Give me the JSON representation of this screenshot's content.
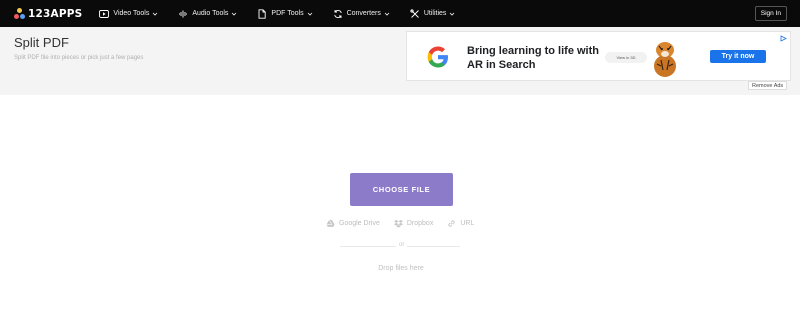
{
  "brand": {
    "name": "123APPS"
  },
  "nav": {
    "items": [
      {
        "label": "Video Tools",
        "icon": "video-play-icon"
      },
      {
        "label": "Audio Tools",
        "icon": "audio-wave-icon"
      },
      {
        "label": "PDF Tools",
        "icon": "pdf-document-icon"
      },
      {
        "label": "Converters",
        "icon": "convert-cycle-icon"
      },
      {
        "label": "Utilities",
        "icon": "tools-icon"
      }
    ],
    "signin_label": "Sign In"
  },
  "page": {
    "title": "Split PDF",
    "subtitle": "Split PDF file into pieces or pick just a few pages"
  },
  "ad": {
    "headline": "Bring learning to life with AR in Search",
    "view_chip": "View in 3D",
    "cta": "Try it now",
    "remove_label": "Remove Ads"
  },
  "upload": {
    "button_label": "CHOOSE FILE",
    "sources": [
      {
        "label": "Google Drive",
        "icon": "google-drive-icon"
      },
      {
        "label": "Dropbox",
        "icon": "dropbox-icon"
      },
      {
        "label": "URL",
        "icon": "link-icon"
      }
    ],
    "or_text": "or",
    "drop_text": "Drop files here"
  },
  "colors": {
    "navbar_bg": "#0a0a0a",
    "accent_button": "#8c7bc9",
    "ad_cta": "#1a73e8"
  }
}
